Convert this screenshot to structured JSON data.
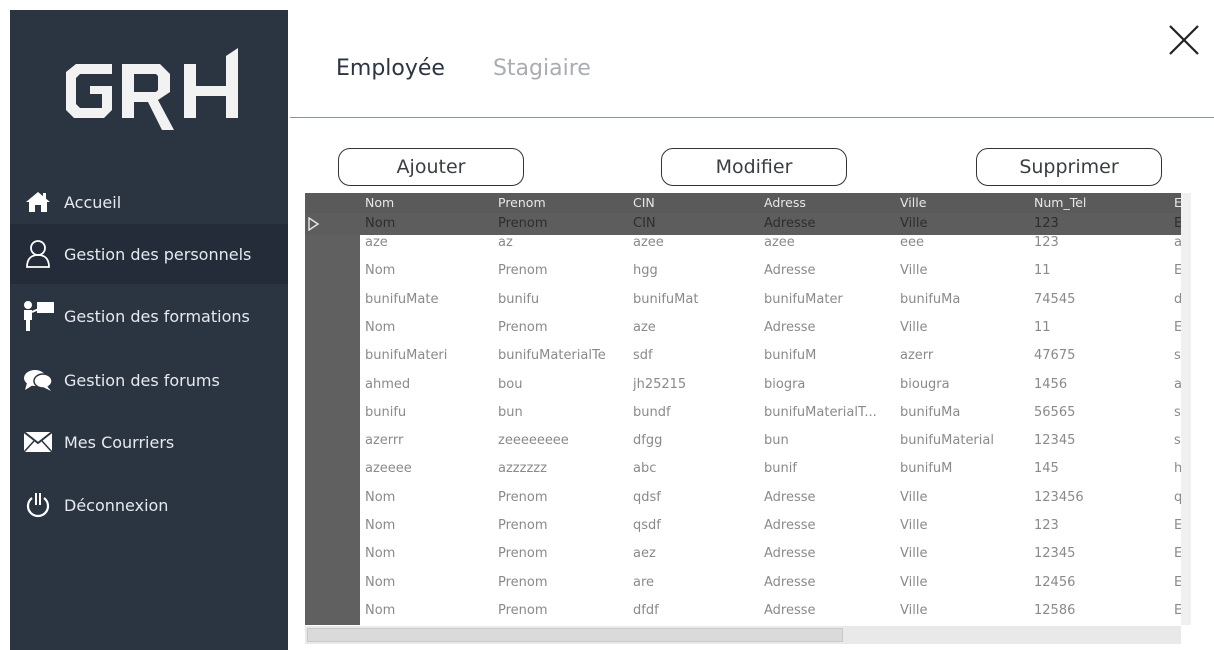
{
  "app": {
    "logo_text": "GRH"
  },
  "sidebar": {
    "items": [
      {
        "label": "Accueil",
        "icon": "home-icon"
      },
      {
        "label": "Gestion des personnels",
        "icon": "user-icon"
      },
      {
        "label": "Gestion des formations",
        "icon": "presentation-icon"
      },
      {
        "label": "Gestion des forums",
        "icon": "chat-bubbles-icon"
      },
      {
        "label": "Mes Courriers",
        "icon": "envelope-icon"
      },
      {
        "label": "Déconnexion",
        "icon": "power-icon"
      }
    ]
  },
  "tabs": [
    {
      "label": "Employée"
    },
    {
      "label": "Stagiaire"
    }
  ],
  "actions": {
    "add": "Ajouter",
    "edit": "Modifier",
    "delete": "Supprimer"
  },
  "table": {
    "columns": [
      "Nom",
      "Prenom",
      "CIN",
      "Adress",
      "Ville",
      "Num_Tel",
      "E"
    ],
    "selected_row": [
      "Nom",
      "Prenom",
      "CIN",
      "Adresse",
      "Ville",
      "123",
      "Er"
    ],
    "rows": [
      [
        "aze",
        "az",
        "azee",
        "azee",
        "eee",
        "123",
        "az"
      ],
      [
        "Nom",
        "Prenom",
        "hgg",
        "Adresse",
        "Ville",
        "11",
        "Er"
      ],
      [
        "bunifuMate",
        "bunifu",
        "bunifuMat",
        "bunifuMater",
        "bunifuMa",
        "74545",
        "dc"
      ],
      [
        "Nom",
        "Prenom",
        "aze",
        "Adresse",
        "Ville",
        "11",
        "Er"
      ],
      [
        "bunifuMateri",
        "bunifuMaterialTe",
        "sdf",
        "bunifuM",
        "azerr",
        "47675",
        "sc"
      ],
      [
        "ahmed",
        "bou",
        "jh25215",
        "biogra",
        "biougra",
        "1456",
        "az"
      ],
      [
        "bunifu",
        "bun",
        "bundf",
        "bunifuMaterialT...",
        "bunifuMa",
        "56565",
        "sf"
      ],
      [
        "azerrr",
        "zeeeeeeee",
        "dfgg",
        "bun",
        "bunifuMaterial",
        "12345",
        "sc"
      ],
      [
        "azeeee",
        "azzzzzz",
        "abc",
        "bunif",
        "bunifuM",
        "145",
        "hl"
      ],
      [
        "Nom",
        "Prenom",
        "qdsf",
        "Adresse",
        "Ville",
        "123456",
        "qc"
      ],
      [
        "Nom",
        "Prenom",
        "qsdf",
        "Adresse",
        "Ville",
        "123",
        "Er"
      ],
      [
        "Nom",
        "Prenom",
        "aez",
        "Adresse",
        "Ville",
        "12345",
        "Er"
      ],
      [
        "Nom",
        "Prenom",
        "are",
        "Adresse",
        "Ville",
        "12456",
        "Er"
      ],
      [
        "Nom",
        "Prenom",
        "dfdf",
        "Adresse",
        "Ville",
        "12586",
        "Er"
      ]
    ]
  },
  "colors": {
    "sidebar_bg": "#2b3542",
    "sidebar_active": "#232c38",
    "grid_header": "#5a5a5a",
    "row_header": "#606060"
  }
}
